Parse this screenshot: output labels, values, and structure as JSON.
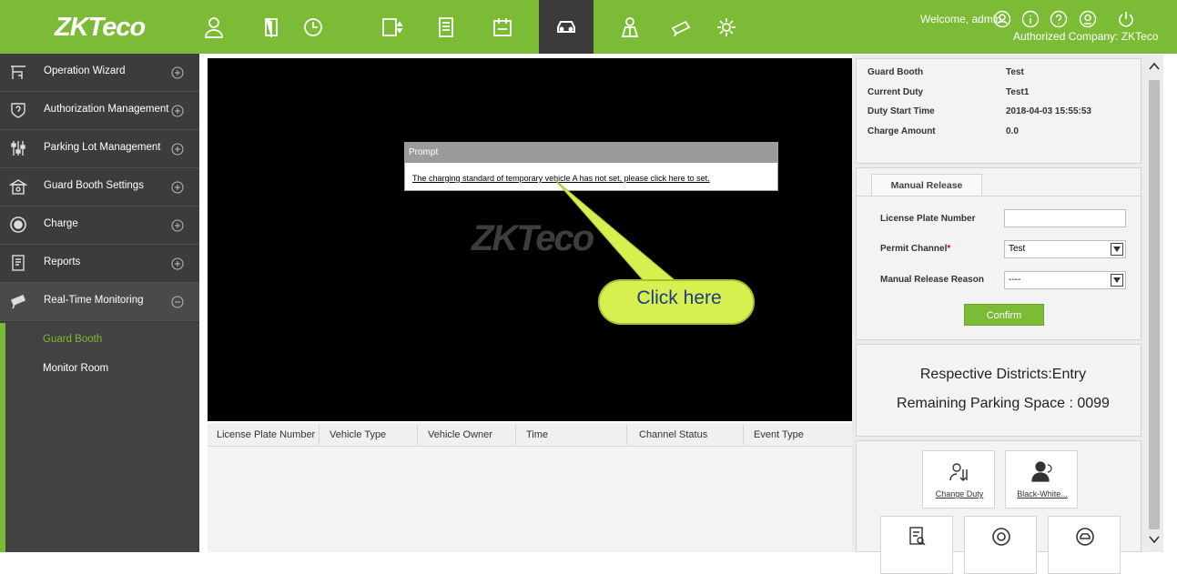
{
  "header": {
    "logo_text": "ZKTeco",
    "welcome": "Welcome, admin",
    "company": "Authorized Company: ZKTeco",
    "modules": [
      "personnel-icon",
      "door-icon",
      "attendance-icon",
      "elevator-icon",
      "visitor-icon",
      "consumer-icon",
      "parking-icon",
      "patrol-icon",
      "video-icon",
      "system-icon"
    ],
    "active_module": "parking-icon",
    "accent": "#7bbb35"
  },
  "sidebar": {
    "items": [
      {
        "label": "Operation Wizard",
        "icon": "wizard-icon",
        "state": "collapsed"
      },
      {
        "label": "Authorization Management",
        "icon": "shield-icon",
        "state": "collapsed"
      },
      {
        "label": "Parking Lot Management",
        "icon": "sliders-icon",
        "state": "collapsed"
      },
      {
        "label": "Guard Booth Settings",
        "icon": "booth-icon",
        "state": "collapsed"
      },
      {
        "label": "Charge",
        "icon": "coin-icon",
        "state": "collapsed"
      },
      {
        "label": "Reports",
        "icon": "report-icon",
        "state": "collapsed"
      },
      {
        "label": "Real-Time Monitoring",
        "icon": "camera-icon",
        "state": "expanded"
      }
    ],
    "sub_items": [
      {
        "label": "Guard Booth",
        "active": true
      },
      {
        "label": "Monitor Room",
        "active": false
      }
    ]
  },
  "video": {
    "watermark": "ZKTeco",
    "prompt_title": "Prompt",
    "prompt_message": "The charging standard of temporary vehicle A has not set, please click here to set.",
    "callout": "Click here"
  },
  "event_table": {
    "columns": [
      "License Plate Number",
      "Vehicle Type",
      "Vehicle Owner",
      "Time",
      "Channel Status",
      "Event Type"
    ],
    "rows": []
  },
  "duty_info": {
    "guard_booth_label": "Guard Booth",
    "guard_booth": "Test",
    "current_duty_label": "Current Duty",
    "current_duty": "Test1",
    "duty_start_label": "Duty Start Time",
    "duty_start": "2018-04-03 15:55:53",
    "charge_amount_label": "Charge Amount",
    "charge_amount": "0.0"
  },
  "manual_release": {
    "tab": "Manual Release",
    "plate_label": "License Plate Number",
    "plate_value": "",
    "channel_label": "Permit Channel",
    "channel_required": "*",
    "channel_value": "Test",
    "reason_label": "Manual Release Reason",
    "reason_value": "----",
    "confirm": "Confirm"
  },
  "parking_status": {
    "district": "Respective Districts:Entry",
    "remaining": "Remaining Parking Space : 0099"
  },
  "quick_actions": [
    {
      "label": "Change Duty",
      "icon": "change-duty-icon"
    },
    {
      "label": "Black-White...",
      "icon": "black-white-icon"
    },
    {
      "label": "",
      "icon": "record-icon"
    },
    {
      "label": "",
      "icon": "coin-icon"
    },
    {
      "label": "",
      "icon": "vehicle-icon"
    }
  ]
}
